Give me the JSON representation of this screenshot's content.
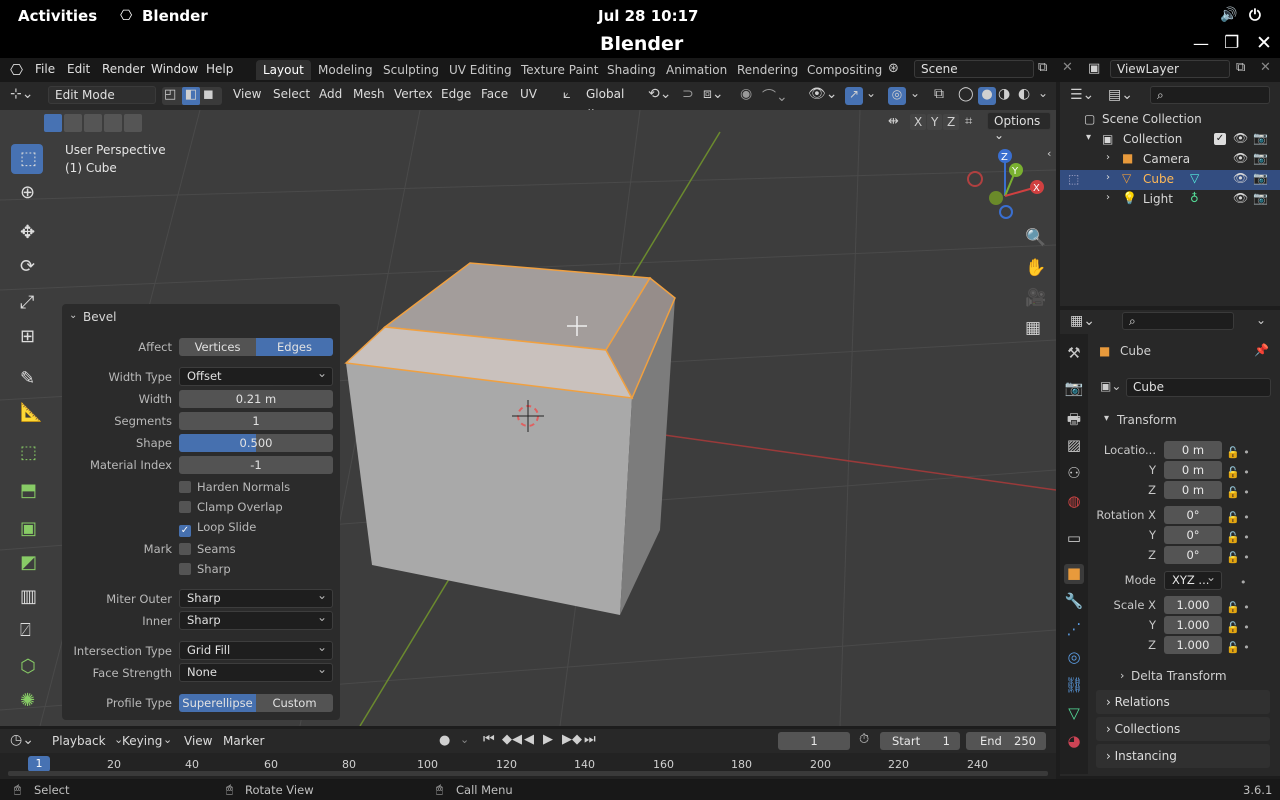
{
  "os": {
    "activities": "Activities",
    "app": "Blender",
    "clock": "Jul 28  10:17"
  },
  "window": {
    "title": "Blender"
  },
  "menu": [
    "File",
    "Edit",
    "Render",
    "Window",
    "Help"
  ],
  "workspaces": [
    "Layout",
    "Modeling",
    "Sculpting",
    "UV Editing",
    "Texture Paint",
    "Shading",
    "Animation",
    "Rendering",
    "Compositing"
  ],
  "scene": "Scene",
  "view_layer": "ViewLayer",
  "vp_header": {
    "mode": "Edit Mode",
    "menus": [
      "View",
      "Select",
      "Add",
      "Mesh",
      "Vertex",
      "Edge",
      "Face",
      "UV"
    ],
    "orientation": "Global",
    "options": "Options",
    "axes": [
      "X",
      "Y",
      "Z"
    ]
  },
  "viewport": {
    "perspective": "User Perspective",
    "object": "(1) Cube",
    "gizmo_axes": {
      "x": "X",
      "y": "Y",
      "z": "Z"
    }
  },
  "bevel": {
    "title": "Bevel",
    "affect_label": "Affect",
    "affect_options": [
      "Vertices",
      "Edges"
    ],
    "affect_selected": "Edges",
    "width_type_label": "Width Type",
    "width_type": "Offset",
    "width_label": "Width",
    "width": "0.21 m",
    "segments_label": "Segments",
    "segments": "1",
    "shape_label": "Shape",
    "shape": "0.500",
    "shape_fraction": 0.5,
    "material_label": "Material Index",
    "material": "-1",
    "harden": "Harden Normals",
    "harden_on": false,
    "clamp": "Clamp Overlap",
    "clamp_on": false,
    "loop": "Loop Slide",
    "loop_on": true,
    "mark_label": "Mark",
    "seams": "Seams",
    "sharp": "Sharp",
    "miter_outer_label": "Miter Outer",
    "miter_outer": "Sharp",
    "inner_label": "Inner",
    "inner": "Sharp",
    "intersection_label": "Intersection Type",
    "intersection": "Grid Fill",
    "face_strength_label": "Face Strength",
    "face_strength": "None",
    "profile_label": "Profile Type",
    "profile_options": [
      "Superellipse",
      "Custom"
    ],
    "profile_selected": "Superellipse"
  },
  "outliner": {
    "root": "Scene Collection",
    "collection": "Collection",
    "items": [
      "Camera",
      "Cube",
      "Light"
    ],
    "selected": "Cube"
  },
  "properties": {
    "object": "Cube",
    "data_name": "Cube",
    "transform": "Transform",
    "location_label": "Locatio...",
    "loc": [
      "0 m",
      "0 m",
      "0 m"
    ],
    "rotation_label": "Rotation X",
    "rot": [
      "0°",
      "0°",
      "0°"
    ],
    "mode_label": "Mode",
    "mode": "XYZ ...",
    "scale_label": "Scale X",
    "scale": [
      "1.000",
      "1.000",
      "1.000"
    ],
    "y": "Y",
    "z": "Z",
    "delta": "Delta Transform",
    "relations": "Relations",
    "collections": "Collections",
    "instancing": "Instancing"
  },
  "timeline": {
    "menus": [
      "Playback",
      "Keying",
      "View",
      "Marker"
    ],
    "current": "1",
    "start_label": "Start",
    "start": "1",
    "end_label": "End",
    "end": "250",
    "ticks": [
      "1",
      "20",
      "40",
      "60",
      "80",
      "100",
      "120",
      "140",
      "160",
      "180",
      "200",
      "220",
      "240"
    ]
  },
  "status": {
    "select": "Select",
    "rotate": "Rotate View",
    "call": "Call Menu",
    "version": "3.6.1"
  }
}
